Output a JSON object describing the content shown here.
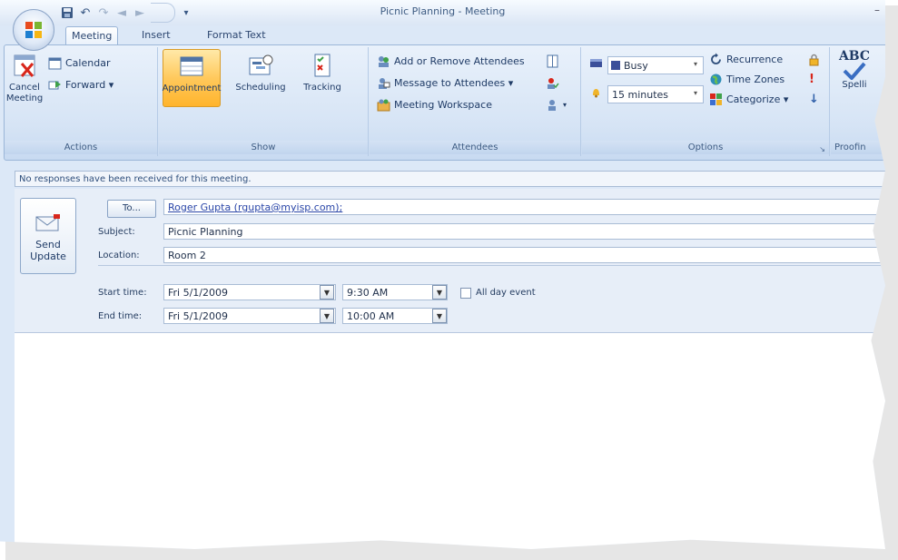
{
  "window": {
    "title": "Picnic  Planning - Meeting",
    "minimize_glyph": "–"
  },
  "tabs": [
    {
      "label": "Meeting",
      "active": true
    },
    {
      "label": "Insert",
      "active": false
    },
    {
      "label": "Format Text",
      "active": false
    }
  ],
  "ribbon": {
    "actions": {
      "label": "Actions",
      "cancel_meeting": "Cancel Meeting",
      "calendar": "Calendar",
      "forward": "Forward ▾"
    },
    "show": {
      "label": "Show",
      "appointment": "Appointment",
      "scheduling": "Scheduling",
      "tracking": "Tracking"
    },
    "attendees": {
      "label": "Attendees",
      "add_remove": "Add or Remove Attendees",
      "message": "Message to Attendees ▾",
      "workspace": "Meeting Workspace"
    },
    "options": {
      "label": "Options",
      "show_as": "Busy",
      "reminder": "15 minutes",
      "recurrence": "Recurrence",
      "time_zones": "Time Zones",
      "categorize": "Categorize ▾"
    },
    "proofing": {
      "label": "Proofin",
      "spelling": "Spelli",
      "abc": "ABC"
    }
  },
  "infobar": {
    "text": "No responses have been received for this meeting."
  },
  "form": {
    "send_update": "Send Update",
    "to_button": "To...",
    "to_value": "Roger Gupta (rgupta@myisp.com);",
    "subject_label": "Subject:",
    "subject_value": "Picnic  Planning",
    "location_label": "Location:",
    "location_value": "Room 2",
    "start_label": "Start time:",
    "start_date": "Fri 5/1/2009",
    "start_time": "9:30 AM",
    "all_day_label": "All day event",
    "all_day_checked": false,
    "end_label": "End time:",
    "end_date": "Fri 5/1/2009",
    "end_time": "10:00 AM"
  },
  "colors": {
    "ribbon_bg": "#d6e4f5",
    "active_button": "#ffc95c",
    "frame": "#dce8f7"
  }
}
